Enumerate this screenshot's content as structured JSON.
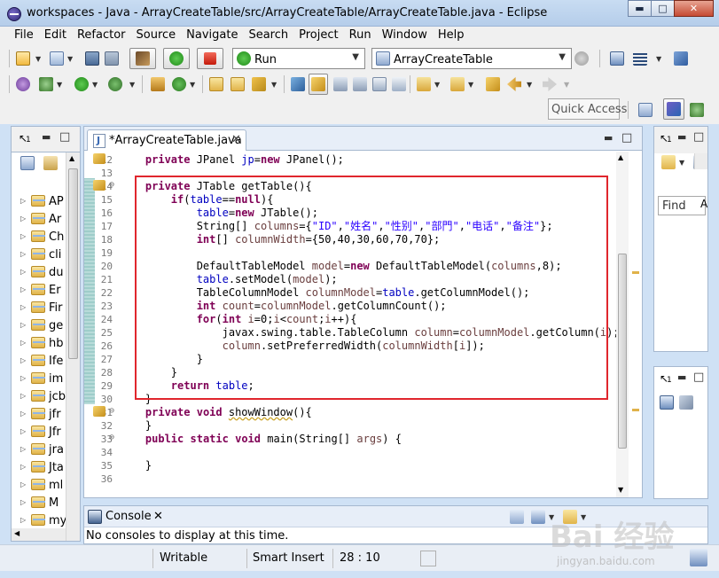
{
  "window": {
    "title": "workspaces - Java - ArrayCreateTable/src/ArrayCreateTable/ArrayCreateTable.java - Eclipse",
    "minimize": "▬",
    "maximize": "□",
    "close": "✕"
  },
  "menu": [
    "File",
    "Edit",
    "Refactor",
    "Source",
    "Navigate",
    "Search",
    "Project",
    "Run",
    "Window",
    "Help"
  ],
  "toolbar": {
    "run_combo": "Run",
    "config_combo": "ArrayCreateTable",
    "quick_access": "Quick Access"
  },
  "left_panel": {
    "tab_number": "1",
    "items": [
      "AP",
      "Ar",
      "Ch",
      "cli",
      "du",
      "Er",
      "Fir",
      "ge",
      "hb",
      "Ife",
      "im",
      "jcb",
      "jfr",
      "Jfr",
      "jra",
      "Jta",
      "ml",
      "M",
      "my"
    ]
  },
  "editor": {
    "tab_label": "*ArrayCreateTable.java",
    "tab_close": "✕",
    "line_numbers": [
      "12",
      "13",
      "14",
      "15",
      "16",
      "17",
      "18",
      "19",
      "20",
      "21",
      "22",
      "23",
      "24",
      "25",
      "26",
      "27",
      "28",
      "29",
      "30",
      "31",
      "32",
      "33",
      "34",
      "35",
      "36"
    ],
    "lines": [
      "    private JPanel jp=new JPanel();",
      "",
      "    private JTable getTable(){",
      "        if(table==null){",
      "            table=new JTable();",
      "            String[] columns={\"ID\",\"姓名\",\"性别\",\"部門\",\"电话\",\"备注\"};",
      "            int[] columnWidth={50,40,30,60,70,70};",
      "",
      "            DefaultTableModel model=new DefaultTableModel(columns,8);",
      "            table.setModel(model);",
      "            TableColumnModel columnModel=table.getColumnModel();",
      "            int count=columnModel.getColumnCount();",
      "            for(int i=0;i<count;i++){",
      "                javax.swing.table.TableColumn column=columnModel.getColumn(i);",
      "                column.setPreferredWidth(columnWidth[i]);",
      "            }",
      "        }",
      "        return table;",
      "    }",
      "    private void showWindow(){",
      "    }",
      "    public static void main(String[] args) {",
      "",
      "    }",
      ""
    ]
  },
  "right_panel": {
    "top_number": "1",
    "find_label": "Find",
    "find_all": "A",
    "bottom_number": "1"
  },
  "console": {
    "title": "Console",
    "close": "✕",
    "message": "No consoles to display at this time."
  },
  "status": {
    "writable": "Writable",
    "insert_mode": "Smart Insert",
    "position": "28 : 10"
  },
  "watermark": {
    "brand": "Bai 经验",
    "url": "jingyan.baidu.com"
  },
  "colors": {
    "highlight_box": "#e0262d",
    "keyword": "#7f0055",
    "field": "#0000c0",
    "string": "#2a00ff"
  }
}
